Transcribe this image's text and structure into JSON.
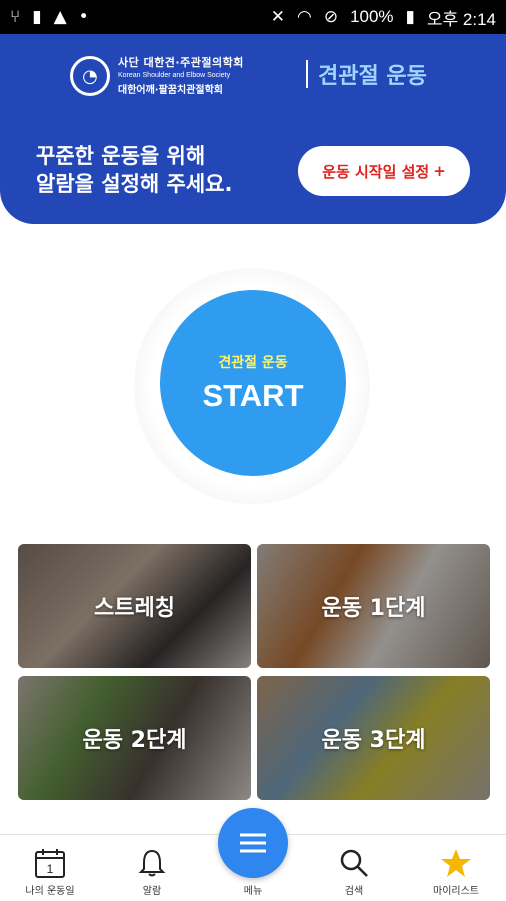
{
  "status": {
    "battery": "100%",
    "time": "오후 2:14"
  },
  "header": {
    "org_line1": "사단 대한견·주관절의학회",
    "org_line2": "Korean Shoulder and Elbow Society",
    "org_line3": "대한어깨·팔꿈치관절학회",
    "title": "견관절 운동",
    "alarm_line1": "꾸준한 운동을 위해",
    "alarm_line2": "알람을 설정해 주세요.",
    "start_date_button": "운동 시작일 설정",
    "start_date_plus": "+"
  },
  "start": {
    "subtitle": "견관절 운동",
    "label": "START"
  },
  "tiles": [
    {
      "label": "스트레칭"
    },
    {
      "label": "운동 1단계"
    },
    {
      "label": "운동 2단계"
    },
    {
      "label": "운동 3단계"
    }
  ],
  "nav": {
    "my_exercise": "나의 운동일",
    "alarm": "알람",
    "menu": "메뉴",
    "search": "검색",
    "mylist": "마이리스트",
    "calendar_day": "1"
  },
  "colors": {
    "header_blue": "#2447b8",
    "start_blue": "#2f9cf0",
    "accent_red": "#e1231e",
    "star_yellow": "#f5b800"
  }
}
